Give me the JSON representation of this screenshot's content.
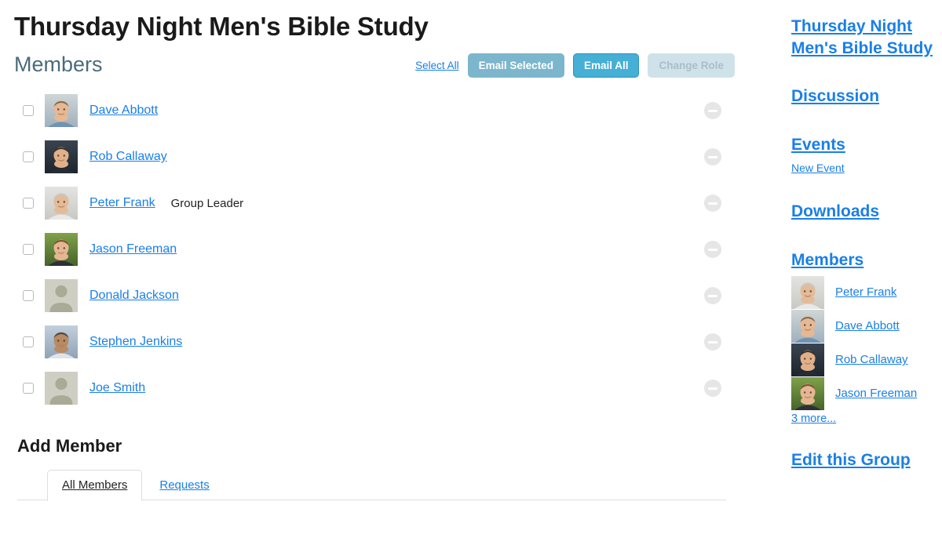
{
  "page": {
    "title": "Thursday Night Men's Bible Study",
    "members_heading": "Members",
    "add_member_heading": "Add Member"
  },
  "toolbar": {
    "select_all": "Select All",
    "email_selected": "Email Selected",
    "email_all": "Email All",
    "change_role": "Change Role",
    "colors": {
      "link": "#1a7fe8",
      "email_selected_bg": "#7cb6cd",
      "email_all_bg": "#45afd6",
      "email_all_border": "#2f94ba",
      "change_role_bg": "#cfe2e9",
      "change_role_text": "#a7bfc8",
      "heading": "#4a6b7c"
    }
  },
  "members": [
    {
      "name": "Dave Abbott",
      "role": "",
      "avatar": "photo",
      "checked": false,
      "remove_icon": "remove-circle-icon"
    },
    {
      "name": "Rob Callaway",
      "role": "",
      "avatar": "photo",
      "checked": false,
      "remove_icon": "remove-circle-icon"
    },
    {
      "name": "Peter Frank",
      "role": "Group Leader",
      "avatar": "photo",
      "checked": false,
      "remove_icon": "remove-circle-icon"
    },
    {
      "name": "Jason Freeman",
      "role": "",
      "avatar": "photo",
      "checked": false,
      "remove_icon": "remove-circle-icon"
    },
    {
      "name": "Donald Jackson",
      "role": "",
      "avatar": "placeholder",
      "checked": false,
      "remove_icon": "remove-circle-icon"
    },
    {
      "name": "Stephen Jenkins",
      "role": "",
      "avatar": "photo",
      "checked": false,
      "remove_icon": "remove-circle-icon"
    },
    {
      "name": "Joe Smith",
      "role": "",
      "avatar": "placeholder",
      "checked": false,
      "remove_icon": "remove-circle-icon"
    }
  ],
  "add_member_tabs": [
    {
      "label": "All Members",
      "active": true
    },
    {
      "label": "Requests",
      "active": false
    }
  ],
  "sidebar": {
    "group_link": "Thursday Night\nMen's Bible Study",
    "discussion": "Discussion",
    "events": "Events",
    "new_event": "New Event",
    "downloads": "Downloads",
    "members_heading": "Members",
    "members": [
      {
        "name": "Peter Frank",
        "avatar": "photo"
      },
      {
        "name": "Dave Abbott",
        "avatar": "photo"
      },
      {
        "name": "Rob Callaway",
        "avatar": "photo"
      },
      {
        "name": "Jason Freeman",
        "avatar": "photo"
      }
    ],
    "more_link": "3 more...",
    "edit_group": "Edit this Group"
  }
}
